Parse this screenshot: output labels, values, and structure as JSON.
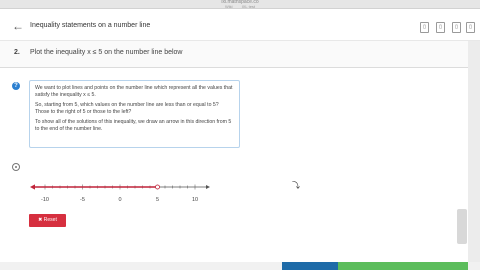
{
  "browser": {
    "url": "ixl.mathspace.co",
    "tabs": [
      "Wiki",
      "IXL test"
    ]
  },
  "header": {
    "back_label": "←",
    "title": "Inequality statements on a number line",
    "tools": [
      "▯",
      "▯",
      "▯",
      "▯"
    ]
  },
  "question": {
    "number": "2.",
    "text": "Plot the inequality x ≤ 5 on the number line below"
  },
  "hint": {
    "p1": "We want to plot lines and points on the number line which represent all the values that satisfy the inequality x ≤ 5.",
    "p2": "So, starting from 5, which values on the number line are less than or equal to 5? Those to the right of 5 or those to the left?",
    "p3": "To show all of the solutions of this inequality, we draw an arrow in this direction from 5 to the end of the number line."
  },
  "number_line": {
    "min": -12,
    "max": 12,
    "tick_labels": [
      {
        "value": -10,
        "label": "-10"
      },
      {
        "value": -5,
        "label": "-5"
      },
      {
        "value": 0,
        "label": "0"
      },
      {
        "value": 5,
        "label": "5"
      },
      {
        "value": 10,
        "label": "10"
      }
    ],
    "point_value": 5,
    "point_closed": false,
    "arrow_direction": "left",
    "colors": {
      "solution": "#c0243a",
      "axis": "#555555"
    }
  },
  "buttons": {
    "reset_label": "Reset"
  }
}
